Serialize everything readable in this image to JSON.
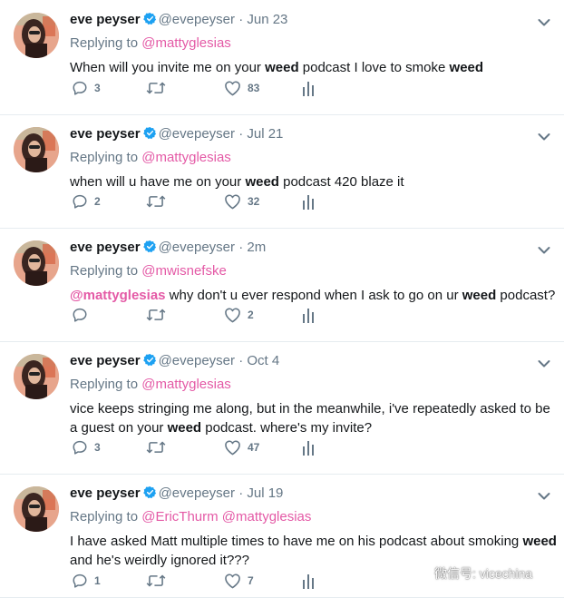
{
  "tweets": [
    {
      "name": "eve peyser",
      "handle": "@evepeyser",
      "dot": "·",
      "time": "Jun 23",
      "replying_prefix": "Replying to",
      "mentions": [
        "@mattyglesias"
      ],
      "text_parts": [
        {
          "t": "When will you invite me on your ",
          "bold": false
        },
        {
          "t": "weed",
          "bold": true
        },
        {
          "t": " podcast I love to smoke ",
          "bold": false
        },
        {
          "t": "weed",
          "bold": true
        }
      ],
      "replies": "3",
      "retweets": "",
      "likes": "83"
    },
    {
      "name": "eve peyser",
      "handle": "@evepeyser",
      "dot": "·",
      "time": "Jul 21",
      "replying_prefix": "Replying to",
      "mentions": [
        "@mattyglesias"
      ],
      "text_parts": [
        {
          "t": "when will u have me on your ",
          "bold": false
        },
        {
          "t": "weed",
          "bold": true
        },
        {
          "t": " podcast 420 blaze it",
          "bold": false
        }
      ],
      "replies": "2",
      "retweets": "",
      "likes": "32"
    },
    {
      "name": "eve peyser",
      "handle": "@evepeyser",
      "dot": "·",
      "time": "2m",
      "replying_prefix": "Replying to",
      "mentions": [
        "@mwisnefske"
      ],
      "text_parts": [
        {
          "t": "@mattyglesias",
          "bold": true,
          "mention": true
        },
        {
          "t": " why don't u ever respond when I ask to go on ur ",
          "bold": false
        },
        {
          "t": "weed",
          "bold": true
        },
        {
          "t": " podcast?",
          "bold": false
        }
      ],
      "replies": "",
      "retweets": "",
      "likes": "2"
    },
    {
      "name": "eve peyser",
      "handle": "@evepeyser",
      "dot": "·",
      "time": "Oct 4",
      "replying_prefix": "Replying to",
      "mentions": [
        "@mattyglesias"
      ],
      "text_parts": [
        {
          "t": "vice keeps stringing me along, but in the meanwhile, i've repeatedly asked to be a guest on your ",
          "bold": false
        },
        {
          "t": "weed",
          "bold": true
        },
        {
          "t": " podcast. where's my invite?",
          "bold": false
        }
      ],
      "replies": "3",
      "retweets": "",
      "likes": "47"
    },
    {
      "name": "eve peyser",
      "handle": "@evepeyser",
      "dot": "·",
      "time": "Jul 19",
      "replying_prefix": "Replying to",
      "mentions": [
        "@EricThurm",
        "@mattyglesias"
      ],
      "text_parts": [
        {
          "t": "I have asked Matt multiple times to have me on his podcast about smoking ",
          "bold": false
        },
        {
          "t": "weed",
          "bold": true
        },
        {
          "t": " and he's weirdly ignored it???",
          "bold": false
        }
      ],
      "replies": "1",
      "retweets": "",
      "likes": "7"
    }
  ],
  "icons": {
    "reply": "reply-icon",
    "retweet": "retweet-icon",
    "like": "heart-icon",
    "analytics": "analytics-icon",
    "more": "chevron-down-icon",
    "verified": "verified-badge-icon"
  },
  "colors": {
    "mention": "#e45aa6",
    "muted": "#657786",
    "verified": "#1da1f2",
    "text": "#14171a"
  },
  "watermark": {
    "text": "微信号: vicechina"
  }
}
